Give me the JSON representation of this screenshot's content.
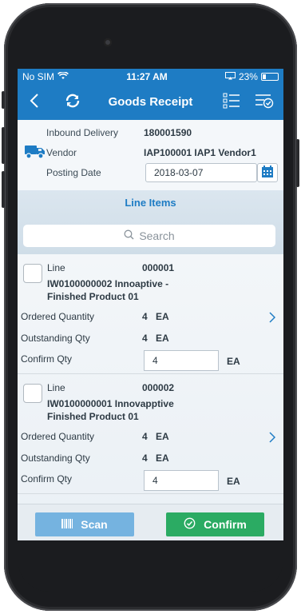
{
  "status_bar": {
    "carrier": "No SIM",
    "time": "11:27 AM",
    "battery": "23%"
  },
  "nav": {
    "title": "Goods Receipt"
  },
  "header": {
    "inbound_delivery_label": "Inbound Delivery",
    "inbound_delivery_value": "180001590",
    "vendor_label": "Vendor",
    "vendor_value": "IAP100001 IAP1 Vendor1",
    "posting_date_label": "Posting Date",
    "posting_date_value": "2018-03-07"
  },
  "line_items_title": "Line Items",
  "search": {
    "placeholder": "Search"
  },
  "items": [
    {
      "line_label": "Line",
      "line_value": "000001",
      "desc1": "IW0100000002 Innoaptive -",
      "desc2": "Finished Product 01",
      "ordered_label": "Ordered Quantity",
      "ordered_value": "4",
      "ordered_unit": "EA",
      "outstanding_label": "Outstanding Qty",
      "outstanding_value": "4",
      "outstanding_unit": "EA",
      "confirm_label": "Confirm Qty",
      "confirm_value": "4",
      "confirm_unit": "EA"
    },
    {
      "line_label": "Line",
      "line_value": "000002",
      "desc1": "IW0100000001 Innovapptive",
      "desc2": "Finished Product 01",
      "ordered_label": "Ordered Quantity",
      "ordered_value": "4",
      "ordered_unit": "EA",
      "outstanding_label": "Outstanding Qty",
      "outstanding_value": "4",
      "outstanding_unit": "EA",
      "confirm_label": "Confirm Qty",
      "confirm_value": "4",
      "confirm_unit": "EA"
    }
  ],
  "footer": {
    "scan_label": "Scan",
    "confirm_label": "Confirm"
  },
  "colors": {
    "primary": "#1e7cc4",
    "confirm": "#2bab63",
    "scan": "#75b3e0"
  },
  "icons": [
    "wifi-icon",
    "battery-icon",
    "back-icon",
    "sync-icon",
    "list-icon",
    "checklist-icon",
    "truck-icon",
    "calendar-icon",
    "search-icon",
    "chevron-right-icon",
    "barcode-icon",
    "confirm-check-icon"
  ]
}
